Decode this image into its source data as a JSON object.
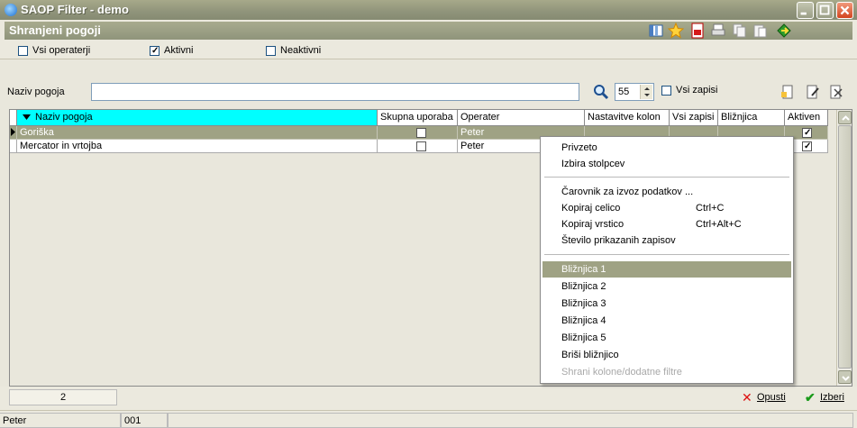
{
  "window": {
    "title": "SAOP Filter  - demo"
  },
  "header": {
    "section_title": "Shranjeni pogoji",
    "toolbar_icons": [
      "columns-icon",
      "star-icon",
      "pdf-icon",
      "print-icon",
      "copy-icon",
      "paste-icon",
      "exit-icon"
    ],
    "checkboxes": [
      {
        "label": "Vsi operaterji",
        "checked": false
      },
      {
        "label": "Aktivni",
        "checked": true
      },
      {
        "label": "Neaktivni",
        "checked": false
      }
    ]
  },
  "filter": {
    "label": "Naziv pogoja",
    "value": "",
    "count": "55",
    "all_records_label": "Vsi zapisi",
    "all_records_checked": false
  },
  "grid": {
    "columns": [
      "Naziv pogoja",
      "Skupna uporaba",
      "Operater",
      "Nastavitve kolon",
      "Vsi zapisi",
      "Bližnjica",
      "Aktiven"
    ],
    "sorted_column": "Naziv pogoja",
    "rows": [
      {
        "name": "Goriška",
        "skupna": false,
        "operater": "Peter",
        "aktiven": true,
        "selected": true
      },
      {
        "name": "Mercator in vrtojba",
        "skupna": false,
        "operater": "Peter",
        "aktiven": true,
        "selected": false
      }
    ]
  },
  "context_menu": {
    "group1": [
      {
        "label": "Privzeto"
      },
      {
        "label": "Izbira stolpcev"
      }
    ],
    "group2": [
      {
        "label": "Čarovnik za izvoz podatkov ...",
        "shortcut": ""
      },
      {
        "label": "Kopiraj celico",
        "shortcut": "Ctrl+C"
      },
      {
        "label": "Kopiraj vrstico",
        "shortcut": "Ctrl+Alt+C"
      },
      {
        "label": "Število prikazanih zapisov",
        "shortcut": ""
      }
    ],
    "group3": [
      {
        "label": "Bližnjica 1",
        "highlighted": true
      },
      {
        "label": "Bližnjica 2"
      },
      {
        "label": "Bližnjica 3"
      },
      {
        "label": "Bližnjica 4"
      },
      {
        "label": "Bližnjica 5"
      },
      {
        "label": "Briši bližnjico"
      },
      {
        "label": "Shrani kolone/dodatne filtre",
        "disabled": true
      }
    ]
  },
  "footer": {
    "record_count": "2",
    "cancel_label": "Opusti",
    "select_label": "Izberi"
  },
  "status": {
    "user": "Peter",
    "code": "001"
  },
  "colors": {
    "titlebar": "#8f937a",
    "selection": "#9fa284",
    "sorted_header": "#00ffff"
  }
}
